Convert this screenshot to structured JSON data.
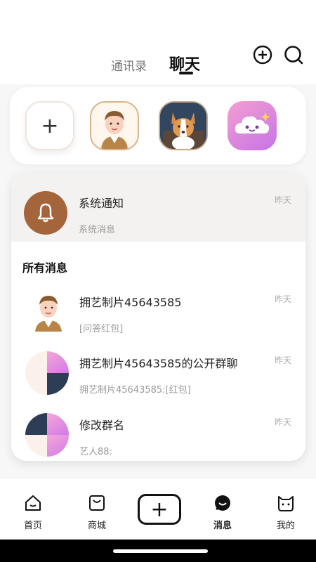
{
  "header": {
    "tabs": [
      {
        "label": "通讯录",
        "active": false
      },
      {
        "label": "聊天",
        "active": true
      }
    ],
    "icons": [
      "add-circle-icon",
      "search-icon"
    ]
  },
  "stories": {
    "add_label": "+",
    "items": [
      "avatar-man-icon",
      "avatar-corgi-icon",
      "avatar-cloud-mascot-icon"
    ]
  },
  "system": {
    "title": "系统通知",
    "subtitle": "系统消息",
    "time": "昨天",
    "icon": "bell-icon"
  },
  "messages": {
    "section_title": "所有消息",
    "items": [
      {
        "title": "拥艺制片45643585",
        "preview": "[问答红包]",
        "time": "昨天"
      },
      {
        "title": "拥艺制片45643585的公开群聊",
        "preview": "拥艺制片45643585:[红包]",
        "time": "昨天"
      },
      {
        "title": "修改群名",
        "preview": "艺人88:",
        "time": "昨天"
      }
    ]
  },
  "bottom_nav": {
    "items": [
      {
        "label": "首页",
        "icon": "home-icon"
      },
      {
        "label": "商城",
        "icon": "shopping-bag-icon"
      },
      {
        "label": "+",
        "icon": "publish-icon"
      },
      {
        "label": "消息",
        "icon": "message-icon",
        "active": true
      },
      {
        "label": "我的",
        "icon": "profile-cat-icon"
      }
    ]
  },
  "colors": {
    "accent": "#a5653c",
    "text": "#222222",
    "muted": "#999999"
  }
}
